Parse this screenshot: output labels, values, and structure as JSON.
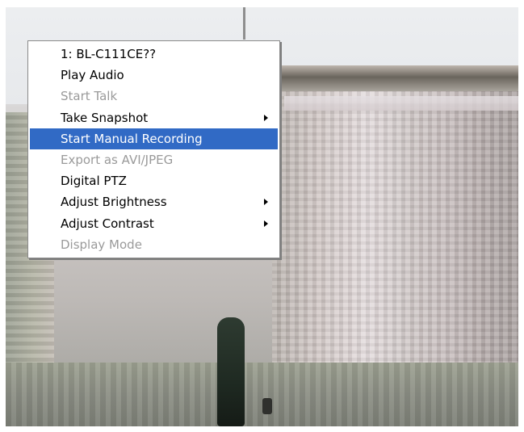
{
  "menu": {
    "items": [
      {
        "label": "1: BL-C111CE??",
        "enabled": true,
        "submenu": false,
        "highlighted": false
      },
      {
        "label": "Play Audio",
        "enabled": true,
        "submenu": false,
        "highlighted": false
      },
      {
        "label": "Start Talk",
        "enabled": false,
        "submenu": false,
        "highlighted": false
      },
      {
        "label": "Take Snapshot",
        "enabled": true,
        "submenu": true,
        "highlighted": false
      },
      {
        "label": "Start Manual Recording",
        "enabled": true,
        "submenu": false,
        "highlighted": true
      },
      {
        "label": "Export as AVI/JPEG",
        "enabled": false,
        "submenu": false,
        "highlighted": false
      },
      {
        "label": "Digital PTZ",
        "enabled": true,
        "submenu": false,
        "highlighted": false
      },
      {
        "label": "Adjust Brightness",
        "enabled": true,
        "submenu": true,
        "highlighted": false
      },
      {
        "label": "Adjust Contrast",
        "enabled": true,
        "submenu": true,
        "highlighted": false
      },
      {
        "label": "Display Mode",
        "enabled": false,
        "submenu": false,
        "highlighted": false
      }
    ]
  },
  "colors": {
    "highlight": "#316ac5",
    "disabled_text": "#9a9a9a",
    "menu_background": "#ffffff"
  }
}
